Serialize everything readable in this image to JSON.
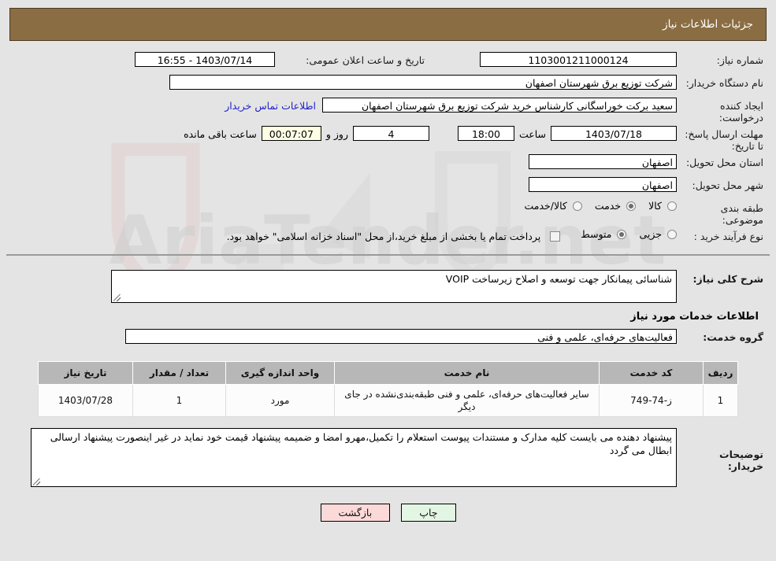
{
  "header": {
    "title": "جزئیات اطلاعات نیاز"
  },
  "fields": {
    "need_number_label": "شماره نیاز:",
    "need_number_value": "1103001211000124",
    "announce_label": "تاریخ و ساعت اعلان عمومی:",
    "announce_value": "1403/07/14 - 16:55",
    "buyer_org_label": "نام دستگاه خریدار:",
    "buyer_org_value": "شرکت توزیع برق شهرستان اصفهان",
    "requester_label": "ایجاد کننده درخواست:",
    "requester_value": "سعید برکت خوراسگانی کارشناس خرید شرکت توزیع برق شهرستان اصفهان",
    "contact_link": "اطلاعات تماس خریدار",
    "deadline_label": "مهلت ارسال پاسخ: تا تاریخ:",
    "deadline_date": "1403/07/18",
    "deadline_hour_label": "ساعت",
    "deadline_hour": "18:00",
    "days_remaining": "4",
    "days_label": "روز و",
    "time_remaining": "00:07:07",
    "time_remaining_label": "ساعت باقی مانده",
    "province_label": "استان محل تحویل:",
    "province_value": "اصفهان",
    "city_label": "شهر محل تحویل:",
    "city_value": "اصفهان",
    "category_label": "طبقه بندی موضوعی:",
    "process_label": "نوع فرآیند خرید :",
    "treasury_note": "پرداخت تمام یا بخشی از مبلغ خرید،از محل \"اسناد خزانه اسلامی\" خواهد بود."
  },
  "category_options": [
    {
      "label": "کالا",
      "selected": false
    },
    {
      "label": "خدمت",
      "selected": true
    },
    {
      "label": "کالا/خدمت",
      "selected": false
    }
  ],
  "process_options": [
    {
      "label": "جزیی",
      "selected": false
    },
    {
      "label": "متوسط",
      "selected": true
    }
  ],
  "description": {
    "label": "شرح کلی نیاز:",
    "value": "شناسائی پیمانکار جهت توسعه و اصلاح زیرساخت VOIP"
  },
  "services_section": {
    "title": "اطلاعات خدمات مورد نیاز",
    "group_label": "گروه خدمت:",
    "group_value": "فعالیت‌های حرفه‌ای، علمی و فنی"
  },
  "table": {
    "columns": [
      "ردیف",
      "کد خدمت",
      "نام خدمت",
      "واحد اندازه گیری",
      "تعداد / مقدار",
      "تاریخ نیاز"
    ],
    "rows": [
      {
        "index": "1",
        "code": "ز-74-749",
        "name": "سایر فعالیت‌های حرفه‌ای، علمی و فنی طبقه‌بندی‌نشده در جای دیگر",
        "unit": "مورد",
        "quantity": "1",
        "date": "1403/07/28"
      }
    ]
  },
  "buyer_notes": {
    "label": "توضیحات خریدار:",
    "value": "پیشنهاد دهنده می بایست کلیه مدارک و مستندات پیوست استعلام را تکمیل،مهرو امضا و ضمیمه پیشنهاد قیمت خود نماید در غیر اینصورت پیشنهاد ارسالی ابطال می گردد"
  },
  "buttons": {
    "print": "چاپ",
    "back": "بازگشت"
  },
  "watermark": {
    "text": "AriaTender.net"
  },
  "colors": {
    "header_bg": "#8b6d43",
    "link": "#2222cc",
    "timer_bg": "#ffffe6",
    "print_btn": "#e3f6e3",
    "back_btn": "#fcd9d9"
  }
}
